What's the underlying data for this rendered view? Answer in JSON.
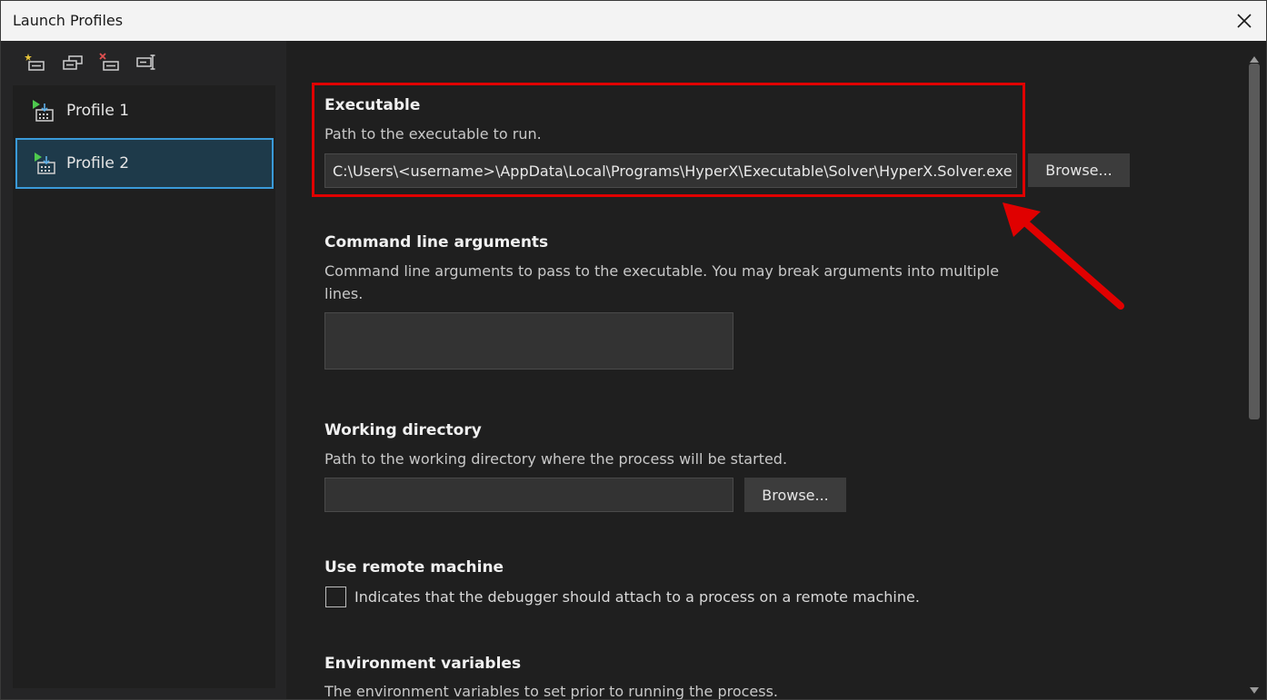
{
  "window": {
    "title": "Launch Profiles"
  },
  "toolbar": {
    "icons": [
      "new-profile-icon",
      "duplicate-profile-icon",
      "delete-profile-icon",
      "rename-profile-icon"
    ]
  },
  "profiles": [
    {
      "label": "Profile 1",
      "selected": false
    },
    {
      "label": "Profile 2",
      "selected": true
    }
  ],
  "executable": {
    "title": "Executable",
    "description": "Path to the executable to run.",
    "value": "C:\\Users\\<username>\\AppData\\Local\\Programs\\HyperX\\Executable\\Solver\\HyperX.Solver.exe",
    "browse_label": "Browse..."
  },
  "arguments": {
    "title": "Command line arguments",
    "description_line1": "Command line arguments to pass to the executable. You may break arguments into multiple",
    "description_line2": "lines.",
    "value": ""
  },
  "working_directory": {
    "title": "Working directory",
    "description": "Path to the working directory where the process will be started.",
    "value": "",
    "browse_label": "Browse..."
  },
  "remote": {
    "title": "Use remote machine",
    "checkbox_label": "Indicates that the debugger should attach to a process on a remote machine.",
    "checked": false
  },
  "environment": {
    "title": "Environment variables",
    "description": "The environment variables to set prior to running the process."
  },
  "colors": {
    "annotation": "#e00000",
    "selection_border": "#3a9ad9",
    "selection_fill": "#1e3a4a",
    "background": "#1f1f1f"
  }
}
